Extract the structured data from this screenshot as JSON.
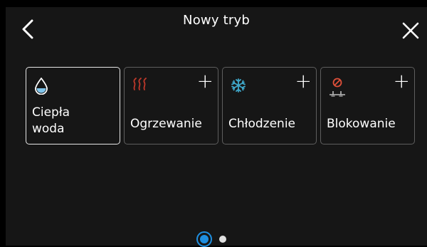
{
  "header": {
    "title": "Nowy tryb",
    "back_icon": "chevron-left-icon",
    "close_icon": "close-icon"
  },
  "cards": [
    {
      "label": "Ciepła\nwoda",
      "icon": "water-drop-icon",
      "selected": true,
      "has_add": false
    },
    {
      "label": "Ogrzewanie",
      "icon": "heating-icon",
      "selected": false,
      "has_add": true,
      "add_label": "+"
    },
    {
      "label": "Chłodzenie",
      "icon": "snowflake-icon",
      "selected": false,
      "has_add": true,
      "add_label": "+"
    },
    {
      "label": "Blokowanie",
      "icon": "blocking-icon",
      "selected": false,
      "has_add": true,
      "add_label": "+"
    }
  ],
  "pager": {
    "pages": 2,
    "current": 1
  },
  "colors": {
    "accent": "#1f8fe0",
    "water": "#7fc4ea",
    "heating": "#c0392b",
    "cooling": "#3fa7c9",
    "blocking": "#e0503a",
    "background": "#161616"
  }
}
